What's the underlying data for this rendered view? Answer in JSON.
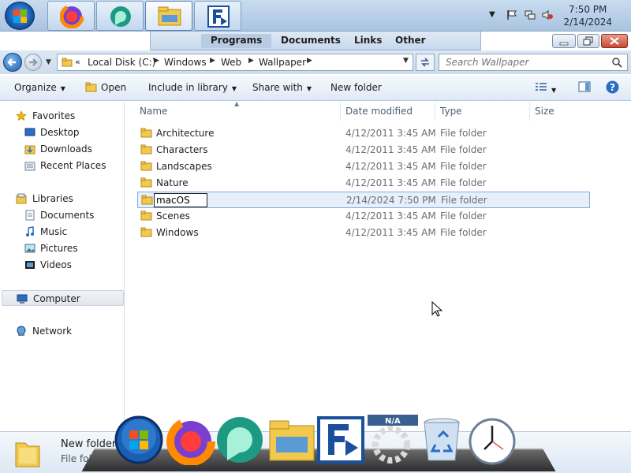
{
  "taskbar": {
    "clock_time": "7:50 PM",
    "clock_date": "2/14/2024",
    "apps": [
      "firefox-icon",
      "app-green-icon",
      "explorer-icon",
      "file-transfer-icon"
    ]
  },
  "menubar": {
    "items": [
      "Programs",
      "Documents",
      "Links",
      "Other"
    ]
  },
  "address": {
    "overflow": "«",
    "crumbs": [
      "Local Disk (C:)",
      "Windows",
      "Web",
      "Wallpaper"
    ]
  },
  "search": {
    "placeholder": "Search Wallpaper"
  },
  "toolbar": {
    "organize": "Organize",
    "open": "Open",
    "include": "Include in library",
    "share": "Share with",
    "new_folder": "New folder"
  },
  "navpane": {
    "favorites": "Favorites",
    "desktop": "Desktop",
    "downloads": "Downloads",
    "recent": "Recent Places",
    "libraries": "Libraries",
    "documents": "Documents",
    "music": "Music",
    "pictures": "Pictures",
    "videos": "Videos",
    "computer": "Computer",
    "network": "Network"
  },
  "columns": {
    "name": "Name",
    "date": "Date modified",
    "type": "Type",
    "size": "Size"
  },
  "files": [
    {
      "name": "Architecture",
      "date": "4/12/2011 3:45 AM",
      "type": "File folder"
    },
    {
      "name": "Characters",
      "date": "4/12/2011 3:45 AM",
      "type": "File folder"
    },
    {
      "name": "Landscapes",
      "date": "4/12/2011 3:45 AM",
      "type": "File folder"
    },
    {
      "name": "Nature",
      "date": "4/12/2011 3:45 AM",
      "type": "File folder"
    },
    {
      "name": "macOS",
      "date": "2/14/2024 7:50 PM",
      "type": "File folder"
    },
    {
      "name": "Scenes",
      "date": "4/12/2011 3:45 AM",
      "type": "File folder"
    },
    {
      "name": "Windows",
      "date": "4/12/2011 3:45 AM",
      "type": "File folder"
    }
  ],
  "details": {
    "name": "New folder",
    "type": "File folder"
  },
  "dock": {
    "na_label": "N/A"
  },
  "colors": {
    "selection_bg": "#e5f0fb",
    "selection_border": "#84acdd",
    "folder_yellow": "#f2c94c"
  }
}
